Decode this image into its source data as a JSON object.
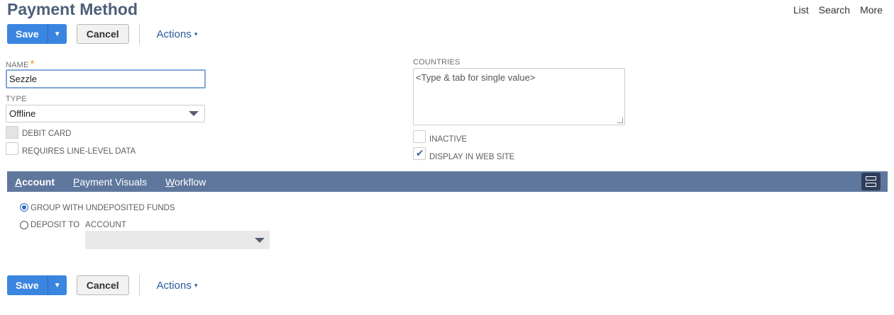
{
  "header": {
    "title": "Payment Method",
    "links": [
      "List",
      "Search",
      "More"
    ]
  },
  "toolbar": {
    "save_label": "Save",
    "save_arrow": "▼",
    "cancel_label": "Cancel",
    "actions_label": "Actions",
    "actions_caret": "▾"
  },
  "form": {
    "name": {
      "label": "NAME",
      "required_mark": "*",
      "value": "Sezzle"
    },
    "type": {
      "label": "TYPE",
      "value": "Offline"
    },
    "debit_card": {
      "label": "DEBIT CARD",
      "checked": false,
      "disabled": true
    },
    "requires_line_level": {
      "label": "REQUIRES LINE-LEVEL DATA",
      "checked": false
    },
    "countries": {
      "label": "COUNTRIES",
      "placeholder": "<Type & tab for single value>"
    },
    "inactive": {
      "label": "INACTIVE",
      "checked": false
    },
    "display_in_web_site": {
      "label": "DISPLAY IN WEB SITE",
      "checked": true,
      "tick": "✔"
    }
  },
  "tabs": [
    {
      "label": "Account",
      "underline_first": "A",
      "rest": "ccount",
      "active": true
    },
    {
      "label": "Payment Visuals",
      "underline_first": "P",
      "rest": "ayment Visuals",
      "active": false
    },
    {
      "label": "Workflow",
      "underline_first": "W",
      "rest": "orkflow",
      "active": false
    }
  ],
  "account_tab": {
    "group_with_undeposited": {
      "label": "GROUP WITH UNDEPOSITED FUNDS",
      "selected": true
    },
    "deposit_to": {
      "label": "DEPOSIT TO",
      "selected": false
    },
    "account_field_label": "ACCOUNT",
    "account_value": ""
  },
  "colors": {
    "title": "#4d5f79",
    "save_button": "#3a85e0",
    "tabbar": "#5f779d",
    "actions": "#2a5b9c",
    "required_mark": "#e79a1d"
  }
}
